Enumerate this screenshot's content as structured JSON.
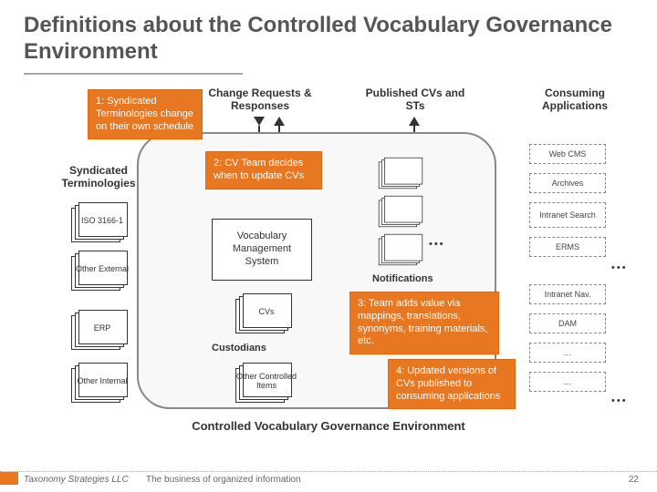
{
  "title": "Definitions about the Controlled Vocabulary Governance Environment",
  "columns": {
    "change": "Change Requests & Responses",
    "published": "Published CVs and STs",
    "consuming": "Consuming Applications"
  },
  "callouts": {
    "c1": "1: Syndicated Terminologies change on their own schedule",
    "c2": "2: CV Team decides when to update CVs",
    "c3": "3: Team adds value via mappings, translations, synonyms, training materials, etc.",
    "c4": "4: Updated versions of CVs published to consuming applications"
  },
  "left_header": "Syndicated Terminologies",
  "left_items": {
    "iso": "ISO 3166-1",
    "other_ext": "Other External",
    "erp": "ERP",
    "other_int": "Other Internal"
  },
  "center": {
    "vms": "Vocabulary Management System",
    "cvs": "CVs",
    "custodians": "Custodians",
    "other_items": "Other Controlled Items"
  },
  "right_apps": {
    "webcms": "Web CMS",
    "archives": "Archives",
    "intranet_search": "Intranet Search",
    "erms": "ERMS",
    "intranet_nav": "Intranet Nav.",
    "dam": "DAM",
    "more1": "…",
    "more2": "…"
  },
  "notifications": "Notifications",
  "env_caption": "Controlled Vocabulary Governance Environment",
  "footer": {
    "company": "Taxonomy Strategies LLC",
    "tagline": "The business of organized information",
    "page": "22"
  }
}
